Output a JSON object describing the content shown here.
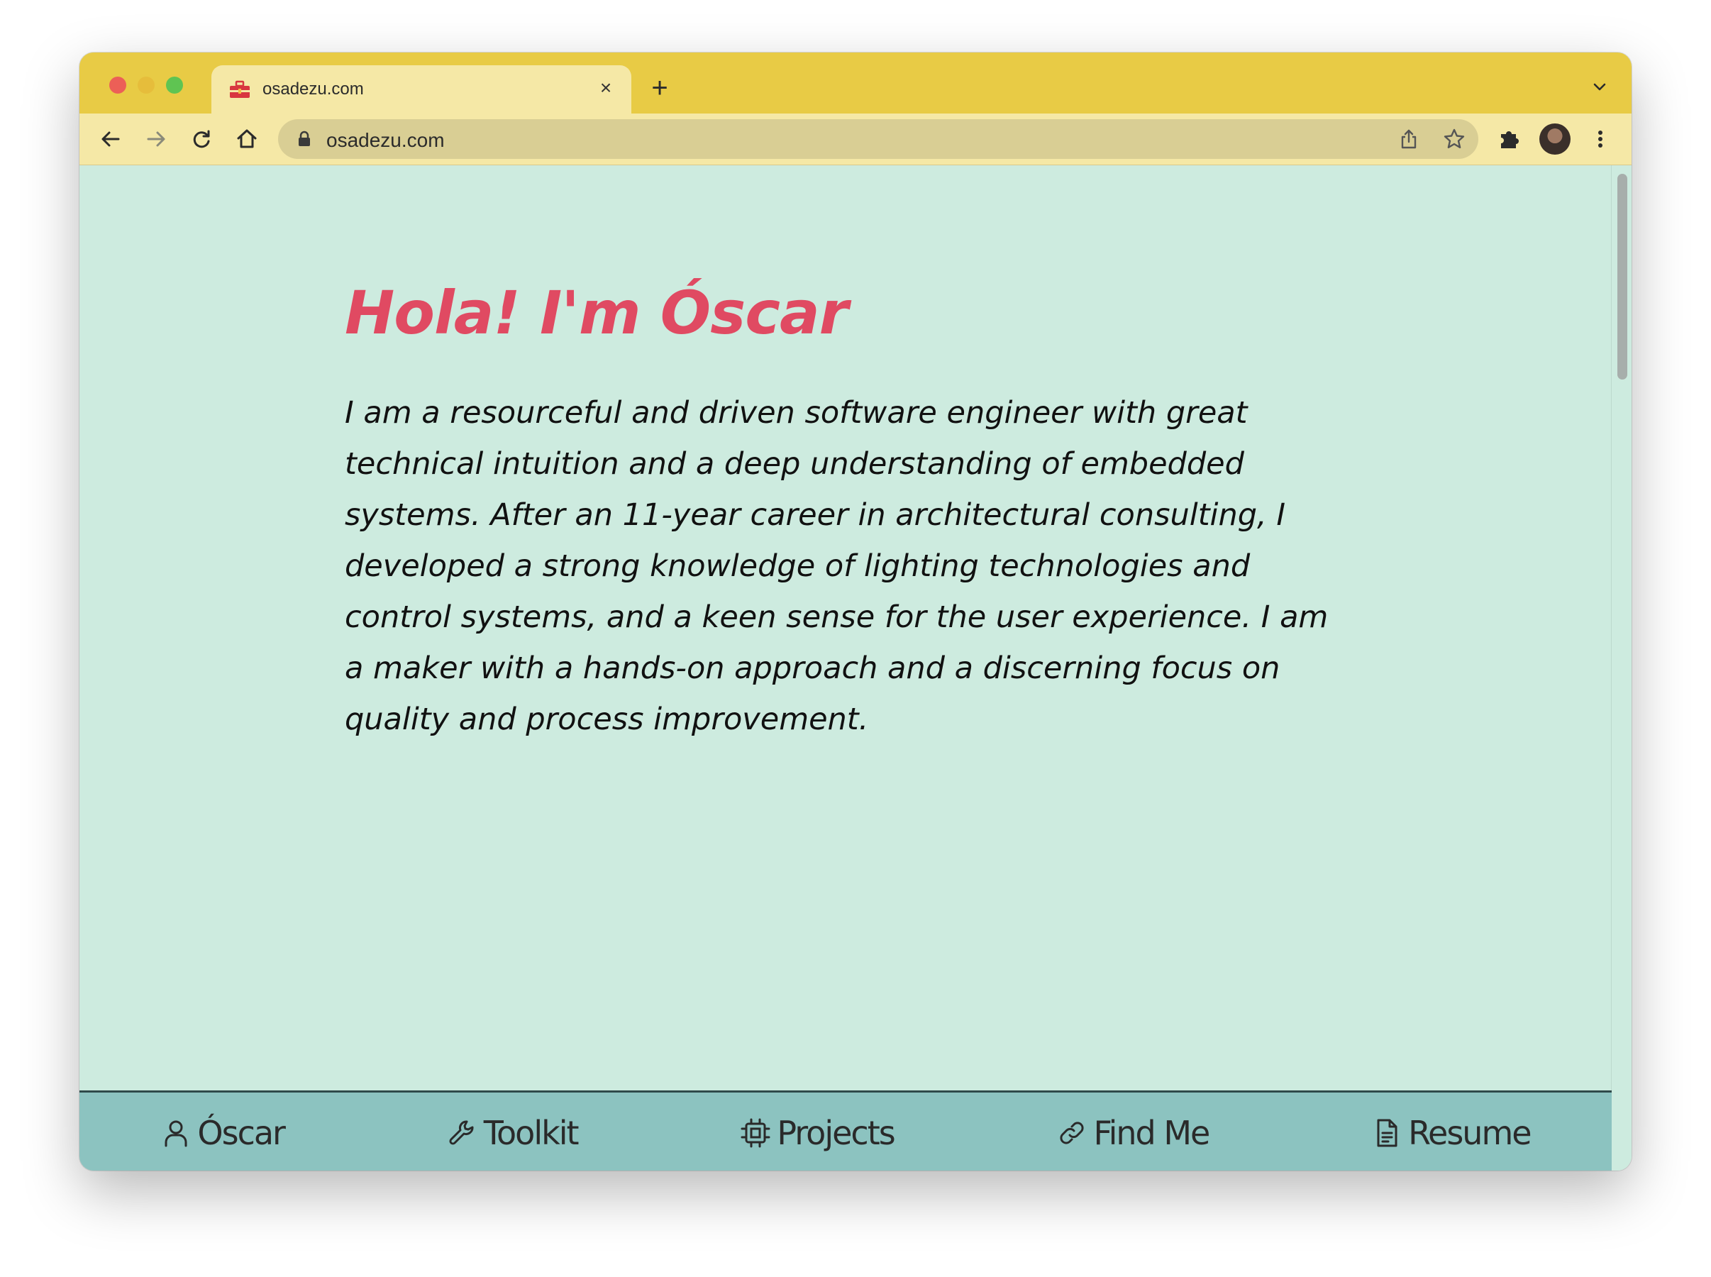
{
  "browser": {
    "tab_title": "osadezu.com",
    "tab_close": "×",
    "new_tab": "+",
    "url": "osadezu.com"
  },
  "hero": {
    "heading": "Hola! I'm Óscar",
    "bio": "I am a resourceful and driven software engineer with great technical intuition and a deep understanding of embedded systems. After an 11-year career in architectural consulting, I developed a strong knowledge of lighting technologies and control systems, and a keen sense for the user experience. I am a maker with a hands-on approach and a discerning focus on quality and process improvement."
  },
  "nav": {
    "items": [
      {
        "label": "Óscar",
        "icon": "user-icon"
      },
      {
        "label": "Toolkit",
        "icon": "wrench-icon"
      },
      {
        "label": "Projects",
        "icon": "chip-icon"
      },
      {
        "label": "Find Me",
        "icon": "link-icon"
      },
      {
        "label": "Resume",
        "icon": "document-icon"
      }
    ]
  },
  "colors": {
    "page_background": "#cdebdf",
    "heading": "#e04a62",
    "nav_background": "#8cc3c0",
    "tab_strip": "#e8cb45",
    "toolbar": "#f5e8a6"
  }
}
